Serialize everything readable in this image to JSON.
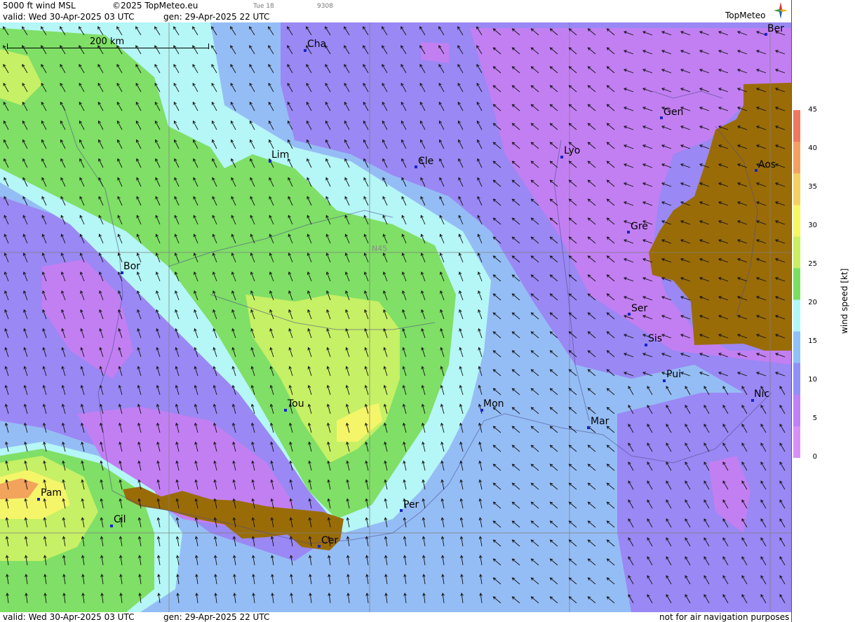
{
  "header": {
    "title": "5000 ft wind MSL",
    "copyright": "©2025 TopMeteo.eu",
    "small_day": "Tue 18",
    "small_code": "9308",
    "valid": "valid:  Wed  30-Apr-2025  03 UTC",
    "generated": "gen: 29-Apr-2025 22 UTC",
    "brand": "TopMeteo"
  },
  "footer": {
    "valid": "valid:  Wed  30-Apr-2025  03 UTC",
    "generated": "gen: 29-Apr-2025 22 UTC",
    "disclaimer": "not for air navigation purposes"
  },
  "map": {
    "scale_label": "200 km",
    "grid_label": "N45",
    "cities": [
      {
        "id": "cha",
        "name": "Cha"
      },
      {
        "id": "ber",
        "name": "Ber"
      },
      {
        "id": "gen",
        "name": "Gen"
      },
      {
        "id": "lim",
        "name": "Lim"
      },
      {
        "id": "cle",
        "name": "Cle"
      },
      {
        "id": "lyo",
        "name": "Lyo"
      },
      {
        "id": "aos",
        "name": "Aos"
      },
      {
        "id": "gre",
        "name": "Gre"
      },
      {
        "id": "bor",
        "name": "Bor"
      },
      {
        "id": "ser",
        "name": "Ser"
      },
      {
        "id": "sis",
        "name": "Sis"
      },
      {
        "id": "pui",
        "name": "Pui"
      },
      {
        "id": "tou",
        "name": "Tou"
      },
      {
        "id": "mon",
        "name": "Mon"
      },
      {
        "id": "nic",
        "name": "Nic"
      },
      {
        "id": "mar",
        "name": "Mar"
      },
      {
        "id": "pam",
        "name": "Pam"
      },
      {
        "id": "cil",
        "name": "Cil"
      },
      {
        "id": "per",
        "name": "Per"
      },
      {
        "id": "cer",
        "name": "Cer"
      }
    ]
  },
  "legend": {
    "unit_label": "wind speed [kt]",
    "ticks": [
      "45",
      "40",
      "35",
      "30",
      "25",
      "20",
      "15",
      "10",
      "5",
      "0"
    ],
    "colors": [
      "#f07860",
      "#f5a060",
      "#f5d060",
      "#f7f760",
      "#c8f060",
      "#78e060",
      "#b0f8f8",
      "#90c0f8",
      "#9090f8",
      "#c080f8",
      "#d890f8"
    ]
  },
  "colors": {
    "calm_violet": "#c27ff2",
    "light_violet": "#9a88f4",
    "blue": "#95bdf5",
    "cyan": "#b5f6f6",
    "green": "#7fdf66",
    "yellow_green": "#c6f065",
    "yellow": "#f5f56a",
    "orange": "#f2a35c",
    "terrain": "#9a6c08"
  }
}
